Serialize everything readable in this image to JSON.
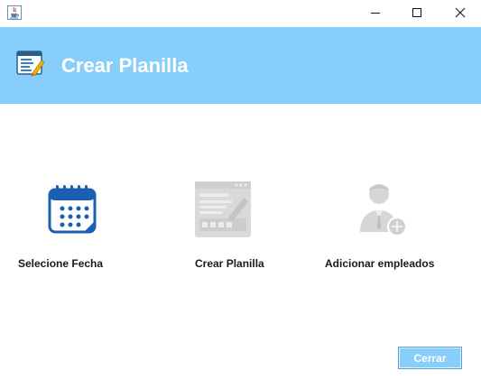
{
  "window": {
    "icon": "java-cup-icon",
    "controls": {
      "minimize": "minimize-icon",
      "maximize": "maximize-icon",
      "close": "close-icon"
    }
  },
  "header": {
    "title": "Crear Planilla",
    "icon": "spreadsheet-edit-icon",
    "background": "#87CEFA"
  },
  "tiles": [
    {
      "label": "Selecione Fecha",
      "icon": "calendar-icon",
      "color": "#1a5fb4"
    },
    {
      "label": "Crear Planilla",
      "icon": "browser-document-icon",
      "color": "#d0d0d0"
    },
    {
      "label": "Adicionar empleados",
      "icon": "add-employee-icon",
      "color": "#d0d0d0"
    }
  ],
  "footer": {
    "close_label": "Cerrar"
  }
}
